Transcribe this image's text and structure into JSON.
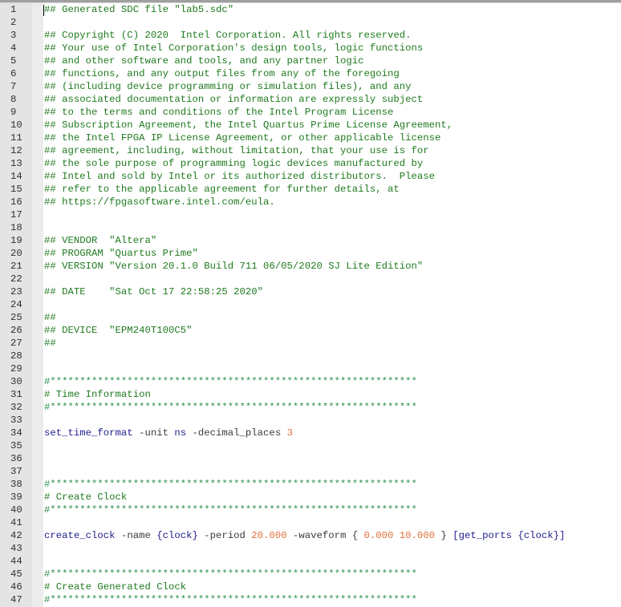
{
  "editor": {
    "line_numbers": [
      "1",
      "2",
      "3",
      "4",
      "5",
      "6",
      "7",
      "8",
      "9",
      "10",
      "11",
      "12",
      "13",
      "14",
      "15",
      "16",
      "17",
      "18",
      "19",
      "20",
      "21",
      "22",
      "23",
      "24",
      "25",
      "26",
      "27",
      "28",
      "29",
      "30",
      "31",
      "32",
      "33",
      "34",
      "35",
      "36",
      "37",
      "38",
      "39",
      "40",
      "41",
      "42",
      "43",
      "44",
      "45",
      "46",
      "47"
    ],
    "lines": [
      {
        "type": "comment",
        "text": "## Generated SDC file \"lab5.sdc\""
      },
      {
        "type": "blank",
        "text": ""
      },
      {
        "type": "comment",
        "text": "## Copyright (C) 2020  Intel Corporation. All rights reserved."
      },
      {
        "type": "comment",
        "text": "## Your use of Intel Corporation's design tools, logic functions"
      },
      {
        "type": "comment",
        "text": "## and other software and tools, and any partner logic"
      },
      {
        "type": "comment",
        "text": "## functions, and any output files from any of the foregoing"
      },
      {
        "type": "comment",
        "text": "## (including device programming or simulation files), and any"
      },
      {
        "type": "comment",
        "text": "## associated documentation or information are expressly subject"
      },
      {
        "type": "comment",
        "text": "## to the terms and conditions of the Intel Program License"
      },
      {
        "type": "comment",
        "text": "## Subscription Agreement, the Intel Quartus Prime License Agreement,"
      },
      {
        "type": "comment",
        "text": "## the Intel FPGA IP License Agreement, or other applicable license"
      },
      {
        "type": "comment",
        "text": "## agreement, including, without limitation, that your use is for"
      },
      {
        "type": "comment",
        "text": "## the sole purpose of programming logic devices manufactured by"
      },
      {
        "type": "comment",
        "text": "## Intel and sold by Intel or its authorized distributors.  Please"
      },
      {
        "type": "comment",
        "text": "## refer to the applicable agreement for further details, at"
      },
      {
        "type": "comment",
        "text": "## https://fpgasoftware.intel.com/eula."
      },
      {
        "type": "blank",
        "text": ""
      },
      {
        "type": "blank",
        "text": ""
      },
      {
        "type": "comment",
        "text": "## VENDOR  \"Altera\""
      },
      {
        "type": "comment",
        "text": "## PROGRAM \"Quartus Prime\""
      },
      {
        "type": "comment",
        "text": "## VERSION \"Version 20.1.0 Build 711 06/05/2020 SJ Lite Edition\""
      },
      {
        "type": "blank",
        "text": ""
      },
      {
        "type": "comment",
        "text": "## DATE    \"Sat Oct 17 22:58:25 2020\""
      },
      {
        "type": "blank",
        "text": ""
      },
      {
        "type": "comment",
        "text": "##"
      },
      {
        "type": "comment",
        "text": "## DEVICE  \"EPM240T100C5\""
      },
      {
        "type": "comment",
        "text": "##"
      },
      {
        "type": "blank",
        "text": ""
      },
      {
        "type": "blank",
        "text": ""
      },
      {
        "type": "stars",
        "text": "#**************************************************************"
      },
      {
        "type": "comment",
        "text": "# Time Information"
      },
      {
        "type": "stars",
        "text": "#**************************************************************"
      },
      {
        "type": "blank",
        "text": ""
      },
      {
        "type": "code",
        "tokens": [
          {
            "k": "cmd",
            "t": "set_time_format"
          },
          {
            "k": "opt",
            "t": " -unit "
          },
          {
            "k": "cmd",
            "t": "ns"
          },
          {
            "k": "opt",
            "t": " -decimal_places "
          },
          {
            "k": "num",
            "t": "3"
          }
        ]
      },
      {
        "type": "blank",
        "text": ""
      },
      {
        "type": "blank",
        "text": ""
      },
      {
        "type": "blank",
        "text": ""
      },
      {
        "type": "stars",
        "text": "#**************************************************************"
      },
      {
        "type": "comment",
        "text": "# Create Clock"
      },
      {
        "type": "stars",
        "text": "#**************************************************************"
      },
      {
        "type": "blank",
        "text": ""
      },
      {
        "type": "code",
        "tokens": [
          {
            "k": "cmd",
            "t": "create_clock"
          },
          {
            "k": "opt",
            "t": " -name "
          },
          {
            "k": "brace",
            "t": "{clock}"
          },
          {
            "k": "opt",
            "t": " -period "
          },
          {
            "k": "num",
            "t": "20.000"
          },
          {
            "k": "opt",
            "t": " -waveform { "
          },
          {
            "k": "num",
            "t": "0.000 10.000"
          },
          {
            "k": "opt",
            "t": " } "
          },
          {
            "k": "brace",
            "t": "[get_ports {clock}]"
          }
        ]
      },
      {
        "type": "blank",
        "text": ""
      },
      {
        "type": "blank",
        "text": ""
      },
      {
        "type": "stars",
        "text": "#**************************************************************"
      },
      {
        "type": "comment",
        "text": "# Create Generated Clock"
      },
      {
        "type": "stars",
        "text": "#**************************************************************"
      }
    ]
  },
  "colors": {
    "comment": "#1f7a1f",
    "command": "#1d1d8c",
    "number": "#e0703a",
    "gutter": "#e4e4e4"
  }
}
